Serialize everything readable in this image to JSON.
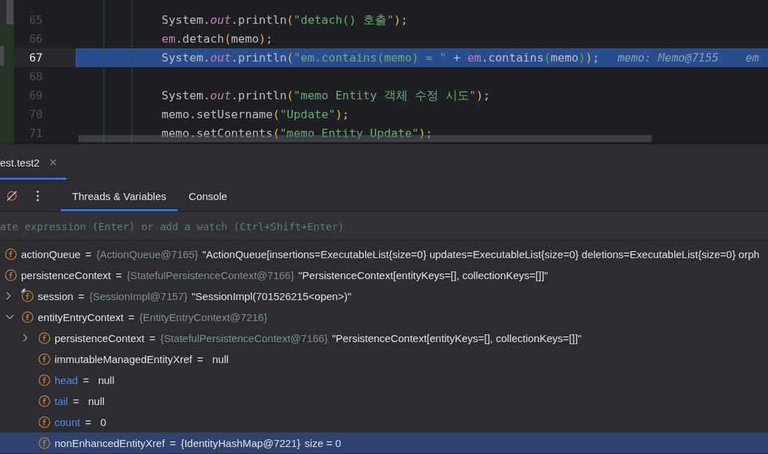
{
  "editor": {
    "lines": [
      {
        "number": "65",
        "current": false,
        "tokens": [
          {
            "kind": "plain",
            "text": "System."
          },
          {
            "kind": "static",
            "text": "out"
          },
          {
            "kind": "plain",
            "text": ".println"
          },
          {
            "kind": "paren",
            "text": "("
          },
          {
            "kind": "string",
            "text": "\"detach() 호출\""
          },
          {
            "kind": "paren",
            "text": ")"
          },
          {
            "kind": "plain",
            "text": ";"
          }
        ]
      },
      {
        "number": "66",
        "current": false,
        "tokens": [
          {
            "kind": "var",
            "text": "em"
          },
          {
            "kind": "plain",
            "text": ".detach"
          },
          {
            "kind": "paren",
            "text": "("
          },
          {
            "kind": "plain",
            "text": "memo"
          },
          {
            "kind": "paren",
            "text": ")"
          },
          {
            "kind": "plain",
            "text": ";"
          }
        ]
      },
      {
        "number": "67",
        "current": true,
        "tokens": [
          {
            "kind": "plain",
            "text": "System."
          },
          {
            "kind": "static",
            "text": "out"
          },
          {
            "kind": "plain",
            "text": ".println"
          },
          {
            "kind": "paren",
            "text": "("
          },
          {
            "kind": "string",
            "text": "\"em.contains(memo) = \""
          },
          {
            "kind": "plain",
            "text": " + "
          },
          {
            "kind": "var",
            "text": "em"
          },
          {
            "kind": "plain",
            "text": ".contains"
          },
          {
            "kind": "paren2",
            "text": "("
          },
          {
            "kind": "plain",
            "text": "memo"
          },
          {
            "kind": "paren2",
            "text": ")"
          },
          {
            "kind": "paren",
            "text": ")"
          },
          {
            "kind": "plain",
            "text": ";"
          }
        ],
        "hint": "memo: Memo@7155    em"
      },
      {
        "number": "68",
        "current": false
      },
      {
        "number": "69",
        "current": false,
        "tokens": [
          {
            "kind": "plain",
            "text": "System."
          },
          {
            "kind": "static",
            "text": "out"
          },
          {
            "kind": "plain",
            "text": ".println"
          },
          {
            "kind": "paren",
            "text": "("
          },
          {
            "kind": "string",
            "text": "\"memo Entity 객체 수정 시도\""
          },
          {
            "kind": "paren",
            "text": ")"
          },
          {
            "kind": "plain",
            "text": ";"
          }
        ]
      },
      {
        "number": "70",
        "current": false,
        "tokens": [
          {
            "kind": "plain",
            "text": "memo.setUsername"
          },
          {
            "kind": "paren",
            "text": "("
          },
          {
            "kind": "string",
            "text": "\"Update\""
          },
          {
            "kind": "paren",
            "text": ")"
          },
          {
            "kind": "plain",
            "text": ";"
          }
        ]
      },
      {
        "number": "71",
        "current": false,
        "tokens": [
          {
            "kind": "plain",
            "text": "memo.setContents"
          },
          {
            "kind": "paren",
            "text": "("
          },
          {
            "kind": "string",
            "text": "\"memo Entity Update\""
          },
          {
            "kind": "paren",
            "text": ")"
          },
          {
            "kind": "plain",
            "text": ";"
          }
        ]
      }
    ]
  },
  "session_tab": {
    "label": "est.test2",
    "selected": true
  },
  "debug_tabs": [
    {
      "label": "Threads & Variables",
      "selected": true
    },
    {
      "label": "Console",
      "selected": false
    }
  ],
  "watch_field": {
    "placeholder": "ate expression (Enter) or add a watch (Ctrl+Shift+Enter)"
  },
  "variables": [
    {
      "name": "actionQueue",
      "color": "#dfe1e5",
      "operator": "=",
      "type": "{ActionQueue@7165}",
      "value": "\"ActionQueue[insertions=ExecutableList{size=0} updates=ExecutableList{size=0} deletions=ExecutableList{size=0} orph",
      "marked": false,
      "selected": false
    },
    {
      "name": "persistenceContext",
      "color": "#dfe1e5",
      "operator": "=",
      "type": "{StatefulPersistenceContext@7166}",
      "value": "\"PersistenceContext[entityKeys=[], collectionKeys=[]]\"",
      "marked": false,
      "selected": false,
      "children": [
        {
          "name": "session",
          "color": "#dfe1e5",
          "operator": "=",
          "type": "{SessionImpl@7157}",
          "value": "\"SessionImpl(701526215<open>)\"",
          "marked": true,
          "selected": false,
          "expanded": false
        },
        {
          "name": "entityEntryContext",
          "color": "#dfe1e5",
          "operator": "=",
          "type": "{EntityEntryContext@7216}",
          "marked": false,
          "selected": false,
          "expanded": true,
          "children": [
            {
              "name": "persistenceContext",
              "color": "#dfe1e5",
              "operator": "=",
              "type": "{StatefulPersistenceContext@7166}",
              "value": "\"PersistenceContext[entityKeys=[], collectionKeys=[]]\"",
              "marked": false,
              "selected": false,
              "expanded": false
            },
            {
              "name": "immutableManagedEntityXref",
              "color": "#dfe1e5",
              "operator": "=",
              "value": "null",
              "marked": false,
              "selected": false
            },
            {
              "name": "head",
              "color": "#548af7",
              "operator": "=",
              "value": "null",
              "marked": false,
              "selected": false
            },
            {
              "name": "tail",
              "color": "#548af7",
              "operator": "=",
              "value": "null",
              "marked": false,
              "selected": false
            },
            {
              "name": "count",
              "color": "#548af7",
              "operator": "=",
              "value": "0",
              "marked": false,
              "selected": false
            },
            {
              "name": "nonEnhancedEntityXref",
              "color": "#dfe1e5",
              "operator": "=",
              "type": "{IdentityHashMap@7221}",
              "value": "size = 0",
              "marked": false,
              "selected": true
            }
          ]
        }
      ]
    }
  ]
}
